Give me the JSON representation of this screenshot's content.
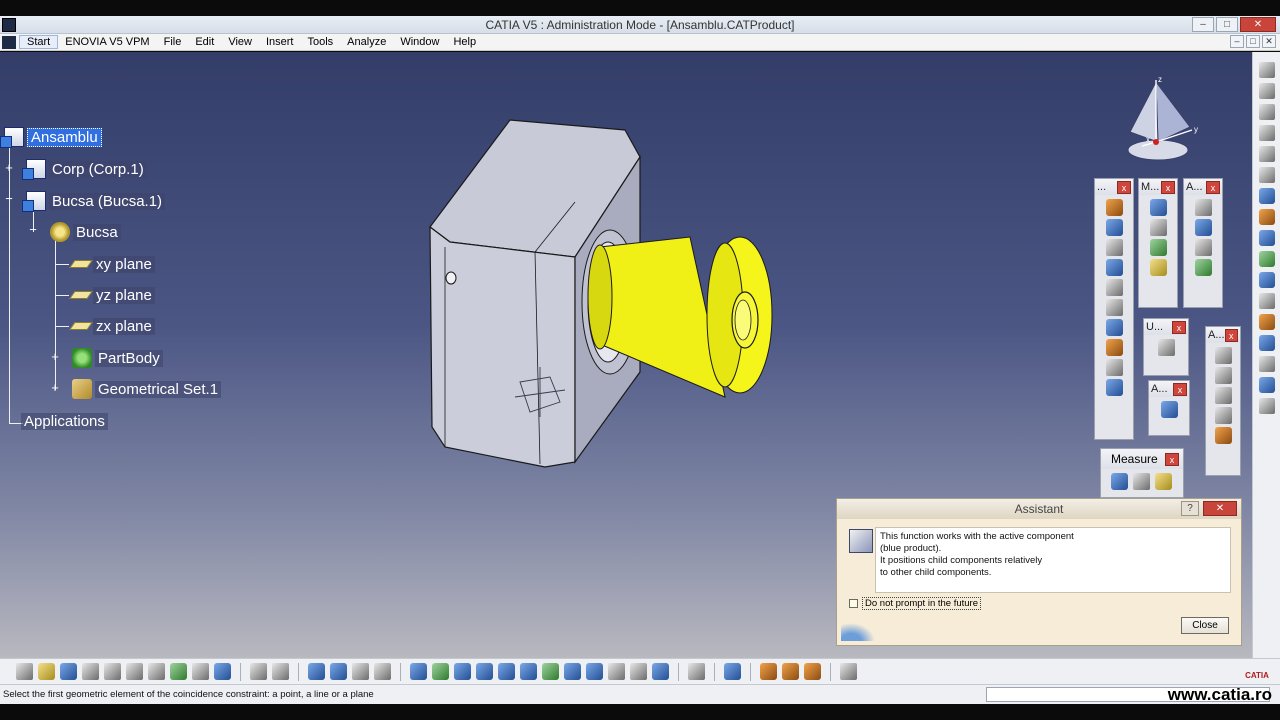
{
  "window": {
    "title": "CATIA V5 : Administration Mode - [Ansamblu.CATProduct]",
    "minimize": "–",
    "maximize": "□",
    "close": "✕"
  },
  "menu": {
    "items": [
      "Start",
      "ENOVIA V5 VPM",
      "File",
      "Edit",
      "View",
      "Insert",
      "Tools",
      "Analyze",
      "Window",
      "Help"
    ]
  },
  "tree": {
    "nodes": [
      {
        "label": "Ansamblu",
        "icon": "product-icon"
      },
      {
        "label": "Corp (Corp.1)",
        "icon": "part-instance-icon"
      },
      {
        "label": "Bucsa (Bucsa.1)",
        "icon": "part-instance-icon"
      },
      {
        "label": "Bucsa",
        "icon": "part-icon"
      },
      {
        "label": "xy plane",
        "icon": "plane-icon"
      },
      {
        "label": "yz plane",
        "icon": "plane-icon"
      },
      {
        "label": "zx plane",
        "icon": "plane-icon"
      },
      {
        "label": "PartBody",
        "icon": "partbody-icon"
      },
      {
        "label": "Geometrical Set.1",
        "icon": "geometrical-set-icon"
      },
      {
        "label": "Applications",
        "icon": ""
      }
    ]
  },
  "compass": {
    "x": "x",
    "y": "y",
    "z": "z"
  },
  "toolbars": {
    "constraints_title": "...",
    "move_title": "M...",
    "assembly_title": "A...",
    "update_title": "U...",
    "annotation_title": "A...",
    "annotation2_title": "A...",
    "measure_title": "Measure"
  },
  "assistant": {
    "title": "Assistant",
    "help": "?",
    "message_lines": [
      "This function works with the active component",
      "(blue product).",
      "It positions child components relatively",
      "to other child components."
    ],
    "checkbox_label": "Do not prompt in the future",
    "close_label": "Close"
  },
  "status": {
    "message": "Select the first geometric element of the coincidence constraint: a point, a line or a plane",
    "watermark": "www.catia.ro"
  },
  "colors": {
    "viewport_top": "#333d68",
    "viewport_bottom": "#b8b8bf",
    "selected_part": "#f2f21a",
    "selection_highlight": "#2f6fe0"
  }
}
